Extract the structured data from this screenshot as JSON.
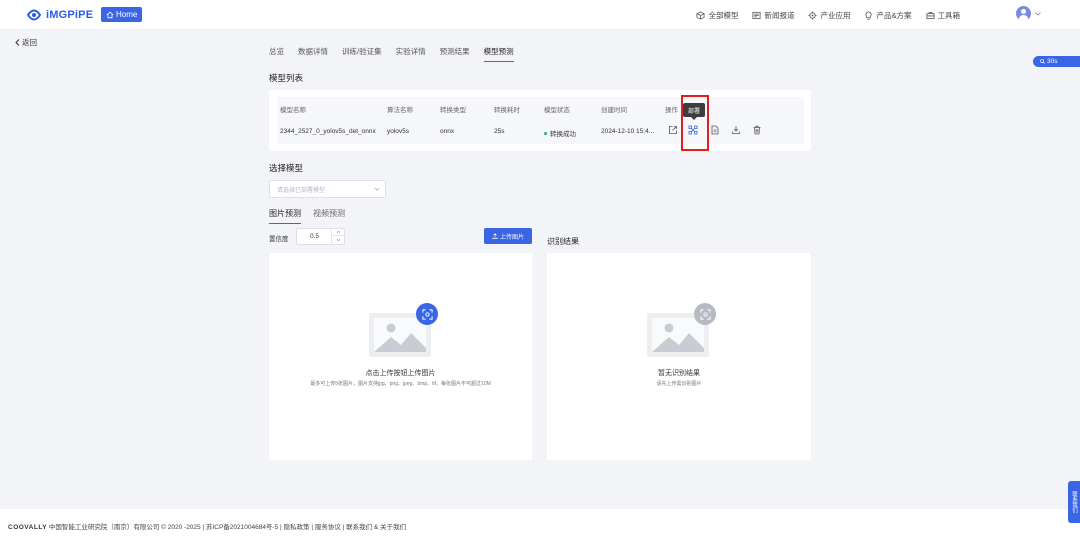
{
  "brand": {
    "logo_text": "iMGPiPE",
    "home_label": "Home"
  },
  "nav": {
    "items": [
      {
        "label": "全部模型",
        "icon": "cube-icon"
      },
      {
        "label": "新闻报道",
        "icon": "news-icon"
      },
      {
        "label": "产业应用",
        "icon": "gear-icon"
      },
      {
        "label": "产品&方案",
        "icon": "bulb-icon"
      },
      {
        "label": "工具箱",
        "icon": "toolbox-icon"
      }
    ]
  },
  "back_label": "返回",
  "float_badge": "30s",
  "tabs": [
    "总览",
    "数据详情",
    "训练/验证集",
    "实验详情",
    "预测结果",
    "模型预测"
  ],
  "active_tab_index": 5,
  "model_list": {
    "title": "模型列表",
    "columns": [
      "模型名称",
      "算法名称",
      "转换类型",
      "转换耗时",
      "模型状态",
      "创建时间",
      "操作"
    ],
    "rows": [
      {
        "name": "2344_2527_0_yolov5s_det_onnx",
        "algorithm": "yolov5s",
        "convert_type": "onnx",
        "duration": "25s",
        "status": "转换成功",
        "created": "2024-12-10 15:4..."
      }
    ],
    "tooltip": "部署",
    "status_color": "#2fb466"
  },
  "select_model": {
    "title": "选择模型",
    "placeholder": "请选择已部署模型"
  },
  "predict_tabs": [
    "图片预测",
    "视频预测"
  ],
  "confidence": {
    "label": "置信度",
    "value": "0.5"
  },
  "upload": {
    "label": "上传图片"
  },
  "result": {
    "title": "识别结果"
  },
  "left_panel": {
    "caption": "点击上传按钮上传图片",
    "hint": "最多可上传5张图片，图片支持jpg、png、jpeg、bmp、tif，每张图片不可超过10M"
  },
  "right_panel": {
    "caption": "暂无识别结果",
    "hint": "请先上传需识别图片"
  },
  "footer": {
    "brand": "COOVALLY",
    "text": "中国智能工业研究院（南京）有限公司 © 2020 -2025 | 苏ICP备2021004684号-5 | 隐私政策 | 服务协议 | 联系我们  &  关于我们"
  },
  "side_contact": "联系我们",
  "colors": {
    "accent": "#3a66e6",
    "highlight": "#e02020"
  }
}
